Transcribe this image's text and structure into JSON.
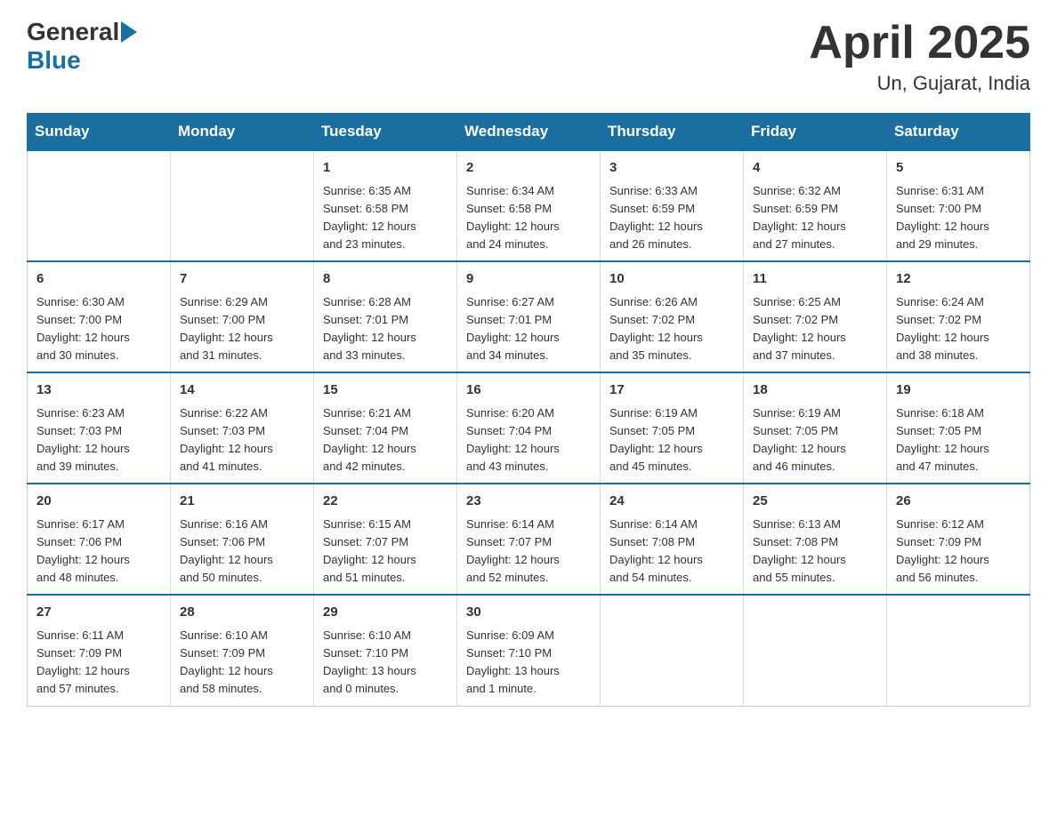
{
  "header": {
    "logo_general": "General",
    "logo_blue": "Blue",
    "month_title": "April 2025",
    "location": "Un, Gujarat, India"
  },
  "days_of_week": [
    "Sunday",
    "Monday",
    "Tuesday",
    "Wednesday",
    "Thursday",
    "Friday",
    "Saturday"
  ],
  "weeks": [
    [
      {
        "day": "",
        "info": ""
      },
      {
        "day": "",
        "info": ""
      },
      {
        "day": "1",
        "info": "Sunrise: 6:35 AM\nSunset: 6:58 PM\nDaylight: 12 hours\nand 23 minutes."
      },
      {
        "day": "2",
        "info": "Sunrise: 6:34 AM\nSunset: 6:58 PM\nDaylight: 12 hours\nand 24 minutes."
      },
      {
        "day": "3",
        "info": "Sunrise: 6:33 AM\nSunset: 6:59 PM\nDaylight: 12 hours\nand 26 minutes."
      },
      {
        "day": "4",
        "info": "Sunrise: 6:32 AM\nSunset: 6:59 PM\nDaylight: 12 hours\nand 27 minutes."
      },
      {
        "day": "5",
        "info": "Sunrise: 6:31 AM\nSunset: 7:00 PM\nDaylight: 12 hours\nand 29 minutes."
      }
    ],
    [
      {
        "day": "6",
        "info": "Sunrise: 6:30 AM\nSunset: 7:00 PM\nDaylight: 12 hours\nand 30 minutes."
      },
      {
        "day": "7",
        "info": "Sunrise: 6:29 AM\nSunset: 7:00 PM\nDaylight: 12 hours\nand 31 minutes."
      },
      {
        "day": "8",
        "info": "Sunrise: 6:28 AM\nSunset: 7:01 PM\nDaylight: 12 hours\nand 33 minutes."
      },
      {
        "day": "9",
        "info": "Sunrise: 6:27 AM\nSunset: 7:01 PM\nDaylight: 12 hours\nand 34 minutes."
      },
      {
        "day": "10",
        "info": "Sunrise: 6:26 AM\nSunset: 7:02 PM\nDaylight: 12 hours\nand 35 minutes."
      },
      {
        "day": "11",
        "info": "Sunrise: 6:25 AM\nSunset: 7:02 PM\nDaylight: 12 hours\nand 37 minutes."
      },
      {
        "day": "12",
        "info": "Sunrise: 6:24 AM\nSunset: 7:02 PM\nDaylight: 12 hours\nand 38 minutes."
      }
    ],
    [
      {
        "day": "13",
        "info": "Sunrise: 6:23 AM\nSunset: 7:03 PM\nDaylight: 12 hours\nand 39 minutes."
      },
      {
        "day": "14",
        "info": "Sunrise: 6:22 AM\nSunset: 7:03 PM\nDaylight: 12 hours\nand 41 minutes."
      },
      {
        "day": "15",
        "info": "Sunrise: 6:21 AM\nSunset: 7:04 PM\nDaylight: 12 hours\nand 42 minutes."
      },
      {
        "day": "16",
        "info": "Sunrise: 6:20 AM\nSunset: 7:04 PM\nDaylight: 12 hours\nand 43 minutes."
      },
      {
        "day": "17",
        "info": "Sunrise: 6:19 AM\nSunset: 7:05 PM\nDaylight: 12 hours\nand 45 minutes."
      },
      {
        "day": "18",
        "info": "Sunrise: 6:19 AM\nSunset: 7:05 PM\nDaylight: 12 hours\nand 46 minutes."
      },
      {
        "day": "19",
        "info": "Sunrise: 6:18 AM\nSunset: 7:05 PM\nDaylight: 12 hours\nand 47 minutes."
      }
    ],
    [
      {
        "day": "20",
        "info": "Sunrise: 6:17 AM\nSunset: 7:06 PM\nDaylight: 12 hours\nand 48 minutes."
      },
      {
        "day": "21",
        "info": "Sunrise: 6:16 AM\nSunset: 7:06 PM\nDaylight: 12 hours\nand 50 minutes."
      },
      {
        "day": "22",
        "info": "Sunrise: 6:15 AM\nSunset: 7:07 PM\nDaylight: 12 hours\nand 51 minutes."
      },
      {
        "day": "23",
        "info": "Sunrise: 6:14 AM\nSunset: 7:07 PM\nDaylight: 12 hours\nand 52 minutes."
      },
      {
        "day": "24",
        "info": "Sunrise: 6:14 AM\nSunset: 7:08 PM\nDaylight: 12 hours\nand 54 minutes."
      },
      {
        "day": "25",
        "info": "Sunrise: 6:13 AM\nSunset: 7:08 PM\nDaylight: 12 hours\nand 55 minutes."
      },
      {
        "day": "26",
        "info": "Sunrise: 6:12 AM\nSunset: 7:09 PM\nDaylight: 12 hours\nand 56 minutes."
      }
    ],
    [
      {
        "day": "27",
        "info": "Sunrise: 6:11 AM\nSunset: 7:09 PM\nDaylight: 12 hours\nand 57 minutes."
      },
      {
        "day": "28",
        "info": "Sunrise: 6:10 AM\nSunset: 7:09 PM\nDaylight: 12 hours\nand 58 minutes."
      },
      {
        "day": "29",
        "info": "Sunrise: 6:10 AM\nSunset: 7:10 PM\nDaylight: 13 hours\nand 0 minutes."
      },
      {
        "day": "30",
        "info": "Sunrise: 6:09 AM\nSunset: 7:10 PM\nDaylight: 13 hours\nand 1 minute."
      },
      {
        "day": "",
        "info": ""
      },
      {
        "day": "",
        "info": ""
      },
      {
        "day": "",
        "info": ""
      }
    ]
  ]
}
